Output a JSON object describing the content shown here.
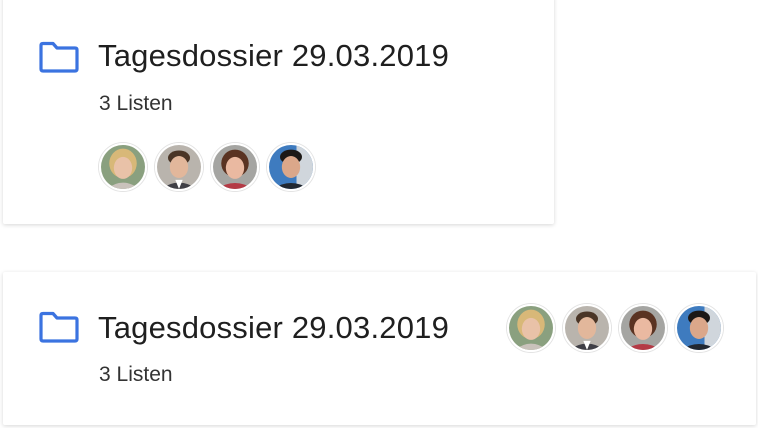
{
  "colors": {
    "accent": "#3b73e0",
    "card_bg": "#ffffff",
    "text": "#1f1f1f"
  },
  "cards": [
    {
      "title": "Tagesdossier 29.03.2019",
      "subtitle": "3 Listen",
      "icon": "folder-icon",
      "avatars": [
        "avatar-1",
        "avatar-2",
        "avatar-3",
        "avatar-4"
      ]
    },
    {
      "title": "Tagesdossier 29.03.2019",
      "subtitle": "3 Listen",
      "icon": "folder-icon",
      "avatars": [
        "avatar-1",
        "avatar-2",
        "avatar-3",
        "avatar-4"
      ]
    }
  ]
}
